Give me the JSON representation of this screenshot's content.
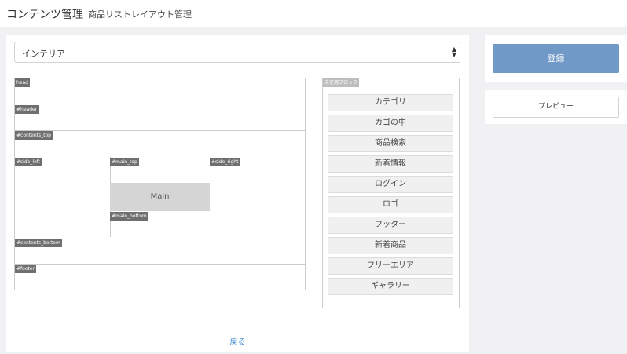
{
  "header": {
    "title": "コンテンツ管理",
    "subtitle": "商品リストレイアウト管理"
  },
  "device_select": {
    "value": "インテリア"
  },
  "layout_areas": {
    "head": "head",
    "header": "#header",
    "contents_top": "#contents_top",
    "side_left": "#side_left",
    "main_top": "#main_top",
    "side_right": "#side_right",
    "main": "Main",
    "main_bottom": "#main_bottom",
    "contents_bottom": "#contents_bottom",
    "footer": "#footer"
  },
  "unused_blocks": {
    "label": "未使用ブロック",
    "items": [
      "カテゴリ",
      "カゴの中",
      "商品検索",
      "新着情報",
      "ログイン",
      "ロゴ",
      "フッター",
      "新着商品",
      "フリーエリア",
      "ギャラリー"
    ]
  },
  "footer_nav": {
    "back": "戻る"
  },
  "actions": {
    "register": "登録",
    "preview": "プレビュー"
  },
  "colors": {
    "primary": "#7199c8",
    "link": "#3d86c6",
    "tag": "#6f6f6f"
  }
}
